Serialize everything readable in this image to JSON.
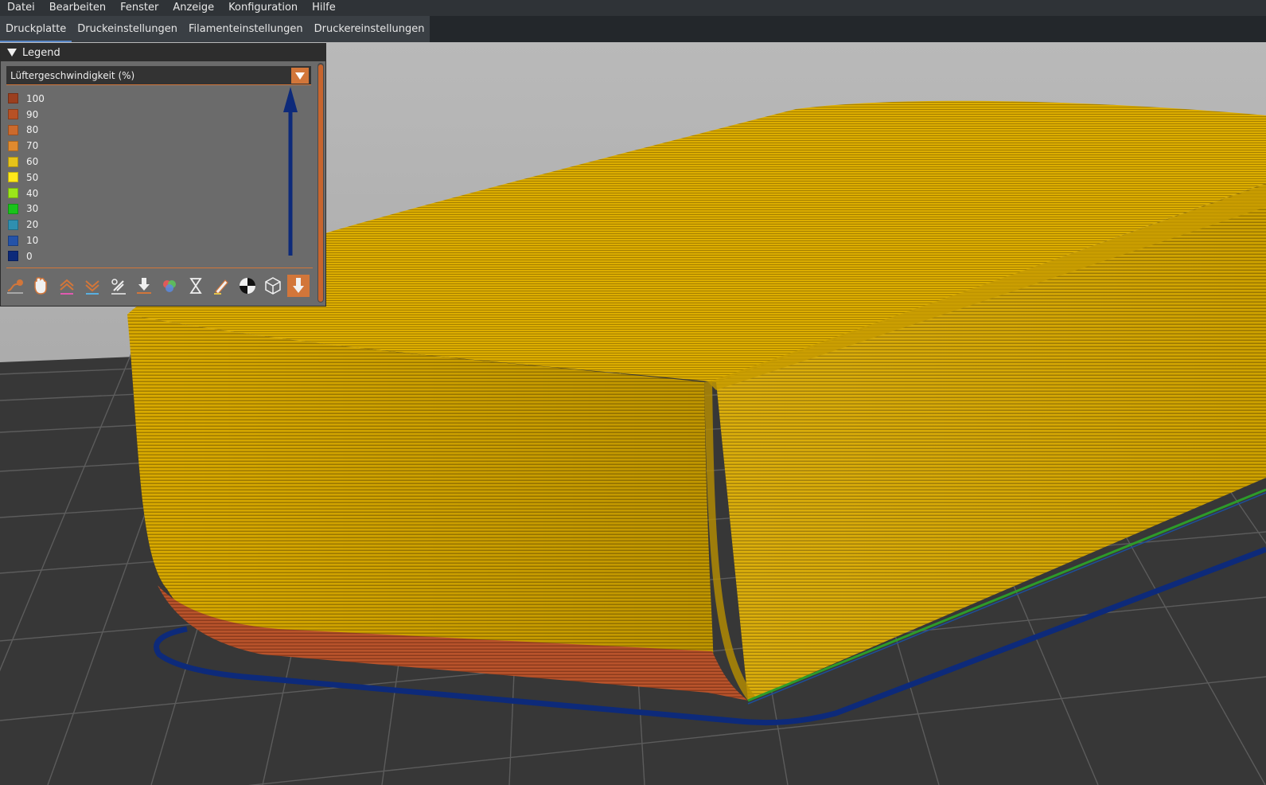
{
  "menu": {
    "items": [
      "Datei",
      "Bearbeiten",
      "Fenster",
      "Anzeige",
      "Konfiguration",
      "Hilfe"
    ]
  },
  "tabs": [
    {
      "label": "Druckplatte",
      "active": true
    },
    {
      "label": "Druckeinstellungen",
      "active": false
    },
    {
      "label": "Filamenteinstellungen",
      "active": false
    },
    {
      "label": "Druckereinstellungen",
      "active": false
    }
  ],
  "legend": {
    "title": "Legend",
    "selected_view": "Lüftergeschwindigkeit (%)",
    "items": [
      {
        "label": "100",
        "color": "#9b3f1f"
      },
      {
        "label": "90",
        "color": "#b75125"
      },
      {
        "label": "80",
        "color": "#cc6a2c"
      },
      {
        "label": "70",
        "color": "#e08a2f"
      },
      {
        "label": "60",
        "color": "#e6c31a"
      },
      {
        "label": "50",
        "color": "#ffe81a"
      },
      {
        "label": "40",
        "color": "#9be61a"
      },
      {
        "label": "30",
        "color": "#19c31a"
      },
      {
        "label": "20",
        "color": "#2f8fb0"
      },
      {
        "label": "10",
        "color": "#2553a8"
      },
      {
        "label": "0",
        "color": "#0d2a7a"
      }
    ],
    "toolbar_icons": [
      "travel-icon",
      "hand-icon",
      "layer-up-icon",
      "layer-down-icon",
      "wipe-icon",
      "retraction-icon",
      "color-change-icon",
      "pause-icon",
      "custom-gcode-icon",
      "center-of-gravity-icon",
      "shells-icon",
      "tool-marker-icon"
    ]
  },
  "colors": {
    "print_yellow": "#d8a900",
    "print_orange": "#b5502a",
    "skirt_blue": "#0d2a7a",
    "accent": "#d2763a"
  }
}
